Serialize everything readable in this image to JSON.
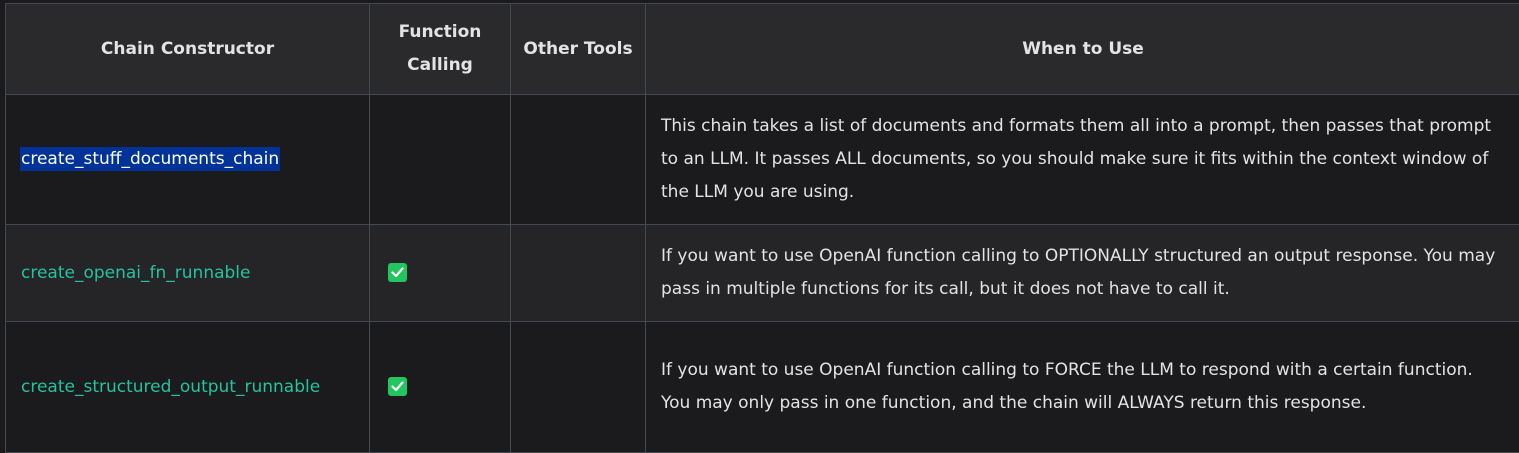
{
  "table": {
    "headers": [
      "Chain Constructor",
      "Function Calling",
      "Other Tools",
      "When to Use"
    ],
    "rows": [
      {
        "name": "create_stuff_documents_chain",
        "function_calling": false,
        "other_tools": false,
        "when_to_use": "This chain takes a list of documents and formats them all into a prompt, then passes that prompt to an LLM. It passes ALL documents, so you should make sure it fits within the context window of the LLM you are using."
      },
      {
        "name": "create_openai_fn_runnable",
        "function_calling": true,
        "other_tools": false,
        "when_to_use": "If you want to use OpenAI function calling to OPTIONALLY structured an output response. You may pass in multiple functions for its call, but it does not have to call it."
      },
      {
        "name": "create_structured_output_runnable",
        "function_calling": true,
        "other_tools": false,
        "when_to_use": "If you want to use OpenAI function calling to FORCE the LLM to respond with a certain function. You may only pass in one function, and the chain will ALWAYS return this response."
      }
    ]
  },
  "icons": {
    "checkmark": "white-check-mark-icon"
  },
  "colors": {
    "background": "#1b1b1d",
    "header_background": "#2a2a2d",
    "link": "#25c2a0",
    "check": "#22c55e",
    "selection": "#003399"
  }
}
